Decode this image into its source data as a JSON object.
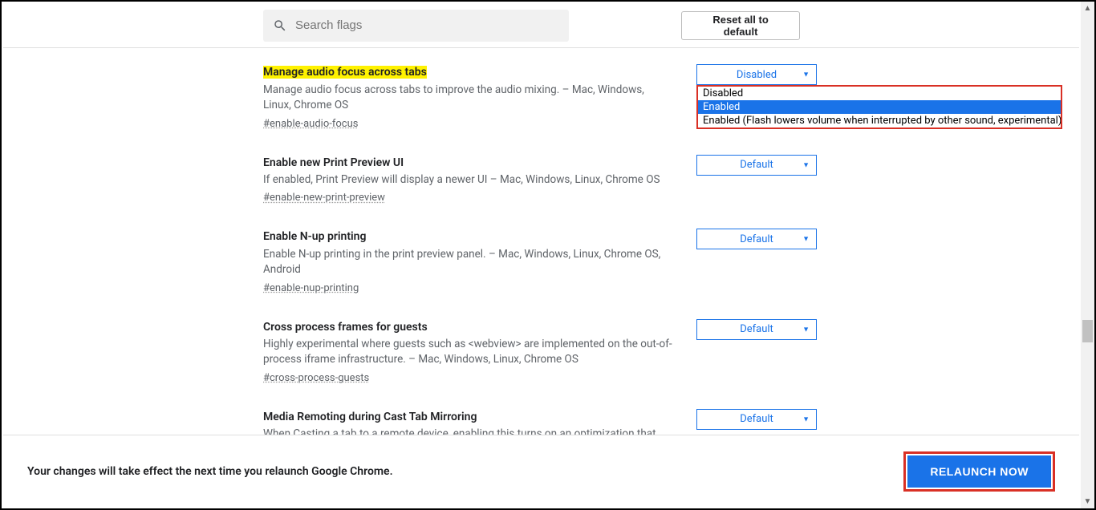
{
  "header": {
    "search_placeholder": "Search flags",
    "reset_label": "Reset all to default"
  },
  "flags": [
    {
      "title": "Manage audio focus across tabs",
      "description": "Manage audio focus across tabs to improve the audio mixing. – Mac, Windows, Linux, Chrome OS",
      "tag": "#enable-audio-focus",
      "value": "Disabled",
      "highlighted": true,
      "dropdown_open": true,
      "options": [
        "Disabled",
        "Enabled",
        "Enabled (Flash lowers volume when interrupted by other sound, experimental)"
      ]
    },
    {
      "title": "Enable new Print Preview UI",
      "description": "If enabled, Print Preview will display a newer UI – Mac, Windows, Linux, Chrome OS",
      "tag": "#enable-new-print-preview",
      "value": "Default"
    },
    {
      "title": "Enable N-up printing",
      "description": "Enable N-up printing in the print preview panel. – Mac, Windows, Linux, Chrome OS, Android",
      "tag": "#enable-nup-printing",
      "value": "Default"
    },
    {
      "title": "Cross process frames for guests",
      "description": "Highly experimental where guests such as <webview> are implemented on the out-of-process iframe infrastructure. – Mac, Windows, Linux, Chrome OS",
      "tag": "#cross-process-guests",
      "value": "Default"
    },
    {
      "title": "Media Remoting during Cast Tab Mirroring",
      "description": "When Casting a tab to a remote device, enabling this turns on an optimization that forwards the content bitstream directly to the remote device when a video is fullscreened",
      "tag": "",
      "value": "Default"
    }
  ],
  "footer": {
    "message": "Your changes will take effect the next time you relaunch Google Chrome.",
    "relaunch_label": "RELAUNCH NOW"
  },
  "colors": {
    "accent": "#1a73e8",
    "highlight": "#fff200",
    "annotation_border": "#d93025",
    "muted_text": "#5f6368"
  }
}
